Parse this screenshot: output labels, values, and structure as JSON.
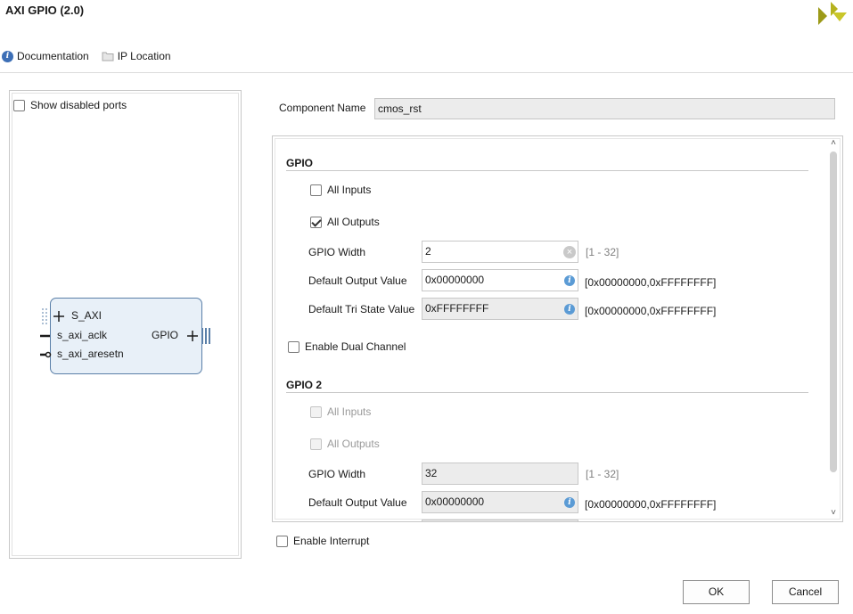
{
  "window": {
    "title": "AXI GPIO (2.0)"
  },
  "toolbar": {
    "documentation": "Documentation",
    "ip_location": "IP Location"
  },
  "left": {
    "show_disabled_ports": "Show disabled ports",
    "ip": {
      "s_axi": "S_AXI",
      "s_axi_aclk": "s_axi_aclk",
      "s_axi_aresetn": "s_axi_aresetn",
      "gpio": "GPIO"
    }
  },
  "component": {
    "label": "Component Name",
    "value": "cmos_rst"
  },
  "gpio": {
    "title": "GPIO",
    "all_inputs": "All Inputs",
    "all_inputs_checked": false,
    "all_outputs": "All Outputs",
    "all_outputs_checked": true,
    "width_label": "GPIO Width",
    "width_value": "2",
    "width_range": "[1 - 32]",
    "dout_label": "Default Output Value",
    "dout_value": "0x00000000",
    "dout_range": "[0x00000000,0xFFFFFFFF]",
    "tri_label": "Default Tri State Value",
    "tri_value": "0xFFFFFFFF",
    "tri_range": "[0x00000000,0xFFFFFFFF]"
  },
  "dual_channel": "Enable Dual Channel",
  "gpio2": {
    "title": "GPIO 2",
    "all_inputs": "All Inputs",
    "all_outputs": "All Outputs",
    "width_label": "GPIO Width",
    "width_value": "32",
    "width_range": "[1 - 32]",
    "dout_label": "Default Output Value",
    "dout_value": "0x00000000",
    "dout_range": "[0x00000000,0xFFFFFFFF]"
  },
  "interrupt": "Enable Interrupt",
  "buttons": {
    "ok": "OK",
    "cancel": "Cancel"
  },
  "colors": {
    "accent": "#5b9bd5",
    "logo": "#b5b21e",
    "ip_block": "#e8f0f8"
  }
}
